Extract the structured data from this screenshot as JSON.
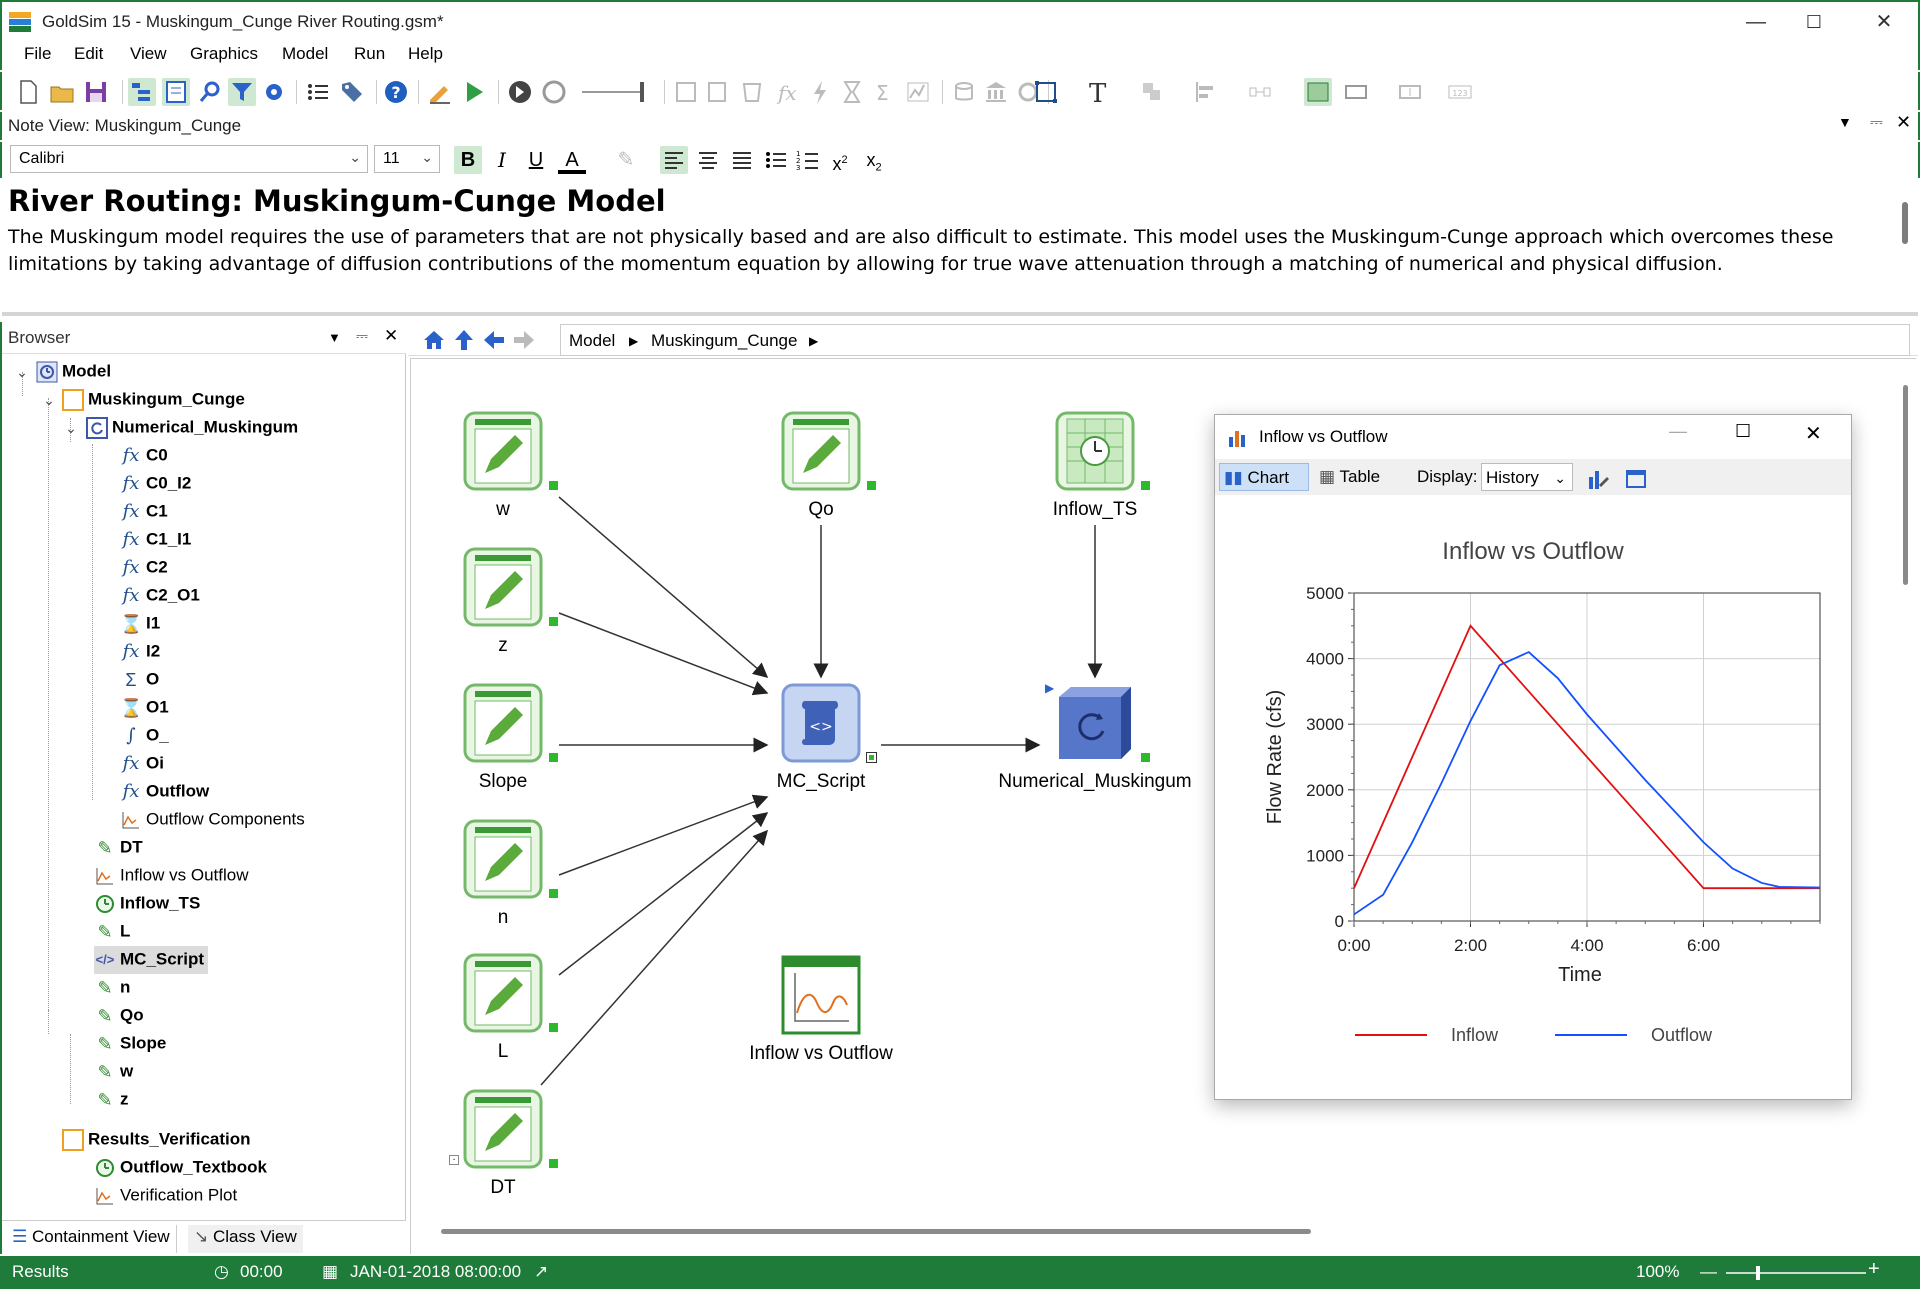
{
  "window": {
    "title": "GoldSim 15  - Muskingum_Cunge River Routing.gsm*"
  },
  "menu": [
    "File",
    "Edit",
    "View",
    "Graphics",
    "Model",
    "Run",
    "Help"
  ],
  "note_view": {
    "header": "Note View: Muskingum_Cunge",
    "font": "Calibri",
    "size": "11",
    "heading": "River Routing: Muskingum-Cunge Model",
    "paragraph": "The Muskingum model requires the use of parameters that are not physically based and are also difficult to estimate. This model uses the Muskingum-Cunge approach which overcomes these limitations by taking advantage of diffusion contributions of the momentum equation by allowing for true wave attenuation through a matching of numerical and physical diffusion."
  },
  "browser": {
    "title": "Browser",
    "tree": [
      {
        "label": "Model",
        "bold": true,
        "icon": "model-icon"
      },
      {
        "label": "Muskingum_Cunge",
        "bold": true,
        "icon": "container-icon"
      },
      {
        "label": "Numerical_Muskingum",
        "bold": true,
        "icon": "looping-container-icon"
      },
      {
        "label": "C0",
        "bold": true,
        "icon": "expression-icon"
      },
      {
        "label": "C0_I2",
        "bold": true,
        "icon": "expression-icon"
      },
      {
        "label": "C1",
        "bold": true,
        "icon": "expression-icon"
      },
      {
        "label": "C1_I1",
        "bold": true,
        "icon": "expression-icon"
      },
      {
        "label": "C2",
        "bold": true,
        "icon": "expression-icon"
      },
      {
        "label": "C2_O1",
        "bold": true,
        "icon": "expression-icon"
      },
      {
        "label": "I1",
        "bold": true,
        "icon": "previous-value-icon"
      },
      {
        "label": "I2",
        "bold": true,
        "icon": "expression-icon"
      },
      {
        "label": "O",
        "bold": true,
        "icon": "sum-icon"
      },
      {
        "label": "O1",
        "bold": true,
        "icon": "previous-value-icon"
      },
      {
        "label": "O_",
        "bold": true,
        "icon": "integrator-icon"
      },
      {
        "label": "Oi",
        "bold": true,
        "icon": "expression-icon"
      },
      {
        "label": "Outflow",
        "bold": true,
        "icon": "expression-icon"
      },
      {
        "label": "Outflow Components",
        "bold": false,
        "icon": "chart-icon"
      },
      {
        "label": "DT",
        "bold": true,
        "icon": "data-icon"
      },
      {
        "label": "Inflow vs Outflow",
        "bold": false,
        "icon": "chart-icon"
      },
      {
        "label": "Inflow_TS",
        "bold": true,
        "icon": "time-series-icon"
      },
      {
        "label": "L",
        "bold": true,
        "icon": "data-icon"
      },
      {
        "label": "MC_Script",
        "bold": true,
        "icon": "script-icon"
      },
      {
        "label": "n",
        "bold": true,
        "icon": "data-icon"
      },
      {
        "label": "Qo",
        "bold": true,
        "icon": "data-icon"
      },
      {
        "label": "Slope",
        "bold": true,
        "icon": "data-icon"
      },
      {
        "label": "w",
        "bold": true,
        "icon": "data-icon"
      },
      {
        "label": "z",
        "bold": true,
        "icon": "data-icon"
      },
      {
        "label": "Results_Verification",
        "bold": true,
        "icon": "container-icon"
      },
      {
        "label": "Outflow_Textbook",
        "bold": true,
        "icon": "time-series-icon"
      },
      {
        "label": "Verification Plot",
        "bold": false,
        "icon": "chart-icon"
      }
    ],
    "tabs": [
      "Containment View",
      "Class View"
    ]
  },
  "breadcrumb": [
    "Model",
    "Muskingum_Cunge"
  ],
  "canvas_nodes": {
    "w": "w",
    "z": "z",
    "slope": "Slope",
    "n": "n",
    "l": "L",
    "dt": "DT",
    "qo": "Qo",
    "script": "MC_Script",
    "inflow_ts": "Inflow_TS",
    "numerical": "Numerical_Muskingum",
    "chart": "Inflow vs Outflow"
  },
  "chart_window": {
    "title": "Inflow vs Outflow",
    "chart_tab": "Chart",
    "table_tab": "Table",
    "display_label": "Display:",
    "display_value": "History"
  },
  "chart_data": {
    "type": "line",
    "title": "Inflow vs Outflow",
    "xlabel": "Time",
    "ylabel": "Flow Rate (cfs)",
    "xlim": [
      0,
      8
    ],
    "ylim": [
      0,
      5000
    ],
    "x_ticks": [
      "0:00",
      "2:00",
      "4:00",
      "6:00"
    ],
    "y_ticks": [
      "0",
      "1000",
      "2000",
      "3000",
      "4000",
      "5000"
    ],
    "grid": true,
    "legend": "bottom",
    "series": [
      {
        "name": "Inflow",
        "color": "#e01010",
        "x": [
          0,
          2.0,
          6.0,
          8.0
        ],
        "y": [
          500,
          4500,
          500,
          500
        ]
      },
      {
        "name": "Outflow",
        "color": "#1450ff",
        "x": [
          0,
          0.5,
          1.0,
          1.5,
          2.0,
          2.5,
          3.0,
          3.5,
          4.0,
          5.0,
          6.0,
          6.5,
          7.0,
          7.3,
          8.0
        ],
        "y": [
          100,
          400,
          1200,
          2100,
          3050,
          3900,
          4100,
          3700,
          3150,
          2150,
          1200,
          800,
          580,
          520,
          510
        ]
      }
    ]
  },
  "status": {
    "mode": "Results",
    "time": "00:00",
    "date": "JAN-01-2018 08:00:00",
    "zoom": "100%"
  }
}
